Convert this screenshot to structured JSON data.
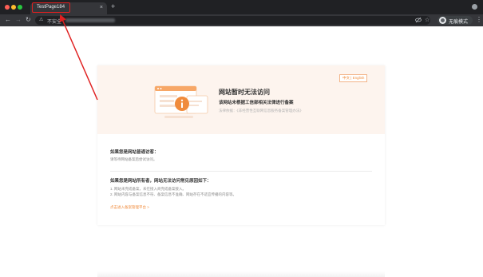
{
  "browser": {
    "tab_title": "TestPage184",
    "tab_close": "×",
    "new_tab": "+",
    "not_secure": "不安全",
    "profile_label": "无痕模式",
    "icons": [
      "close-icon",
      "plus-icon",
      "back-arrow-icon",
      "forward-arrow-icon",
      "reload-icon",
      "warning-icon",
      "eye-slash-icon",
      "star-icon",
      "avatar-icon",
      "menu-icon"
    ]
  },
  "page": {
    "lang_switch": "中文 | English",
    "title": "网站暂时无法访问",
    "subtitle": "该网站未根据工信部相关法律进行备案",
    "basis": "法律依据：《非经营性互联网信息服务备案管理办法》",
    "visitor": {
      "title": "如果您是网站普通访客：",
      "text": "请等待网站备案后尝试访问。"
    },
    "owner": {
      "title": "如果您是网站所有者，网站无法访问常见原因如下：",
      "reasons": [
        "1. 网站未完成备案，未在接入商完成备案接入。",
        "2. 网站内容与备案信息不符、备案信息不准确、网站存在不适宜传播的内容等。"
      ],
      "link": "点击进入备案管理平台 >"
    }
  },
  "colors": {
    "accent": "#f08b3c",
    "banner_bg": "#fdf4ee",
    "annotation": "#e02020"
  }
}
